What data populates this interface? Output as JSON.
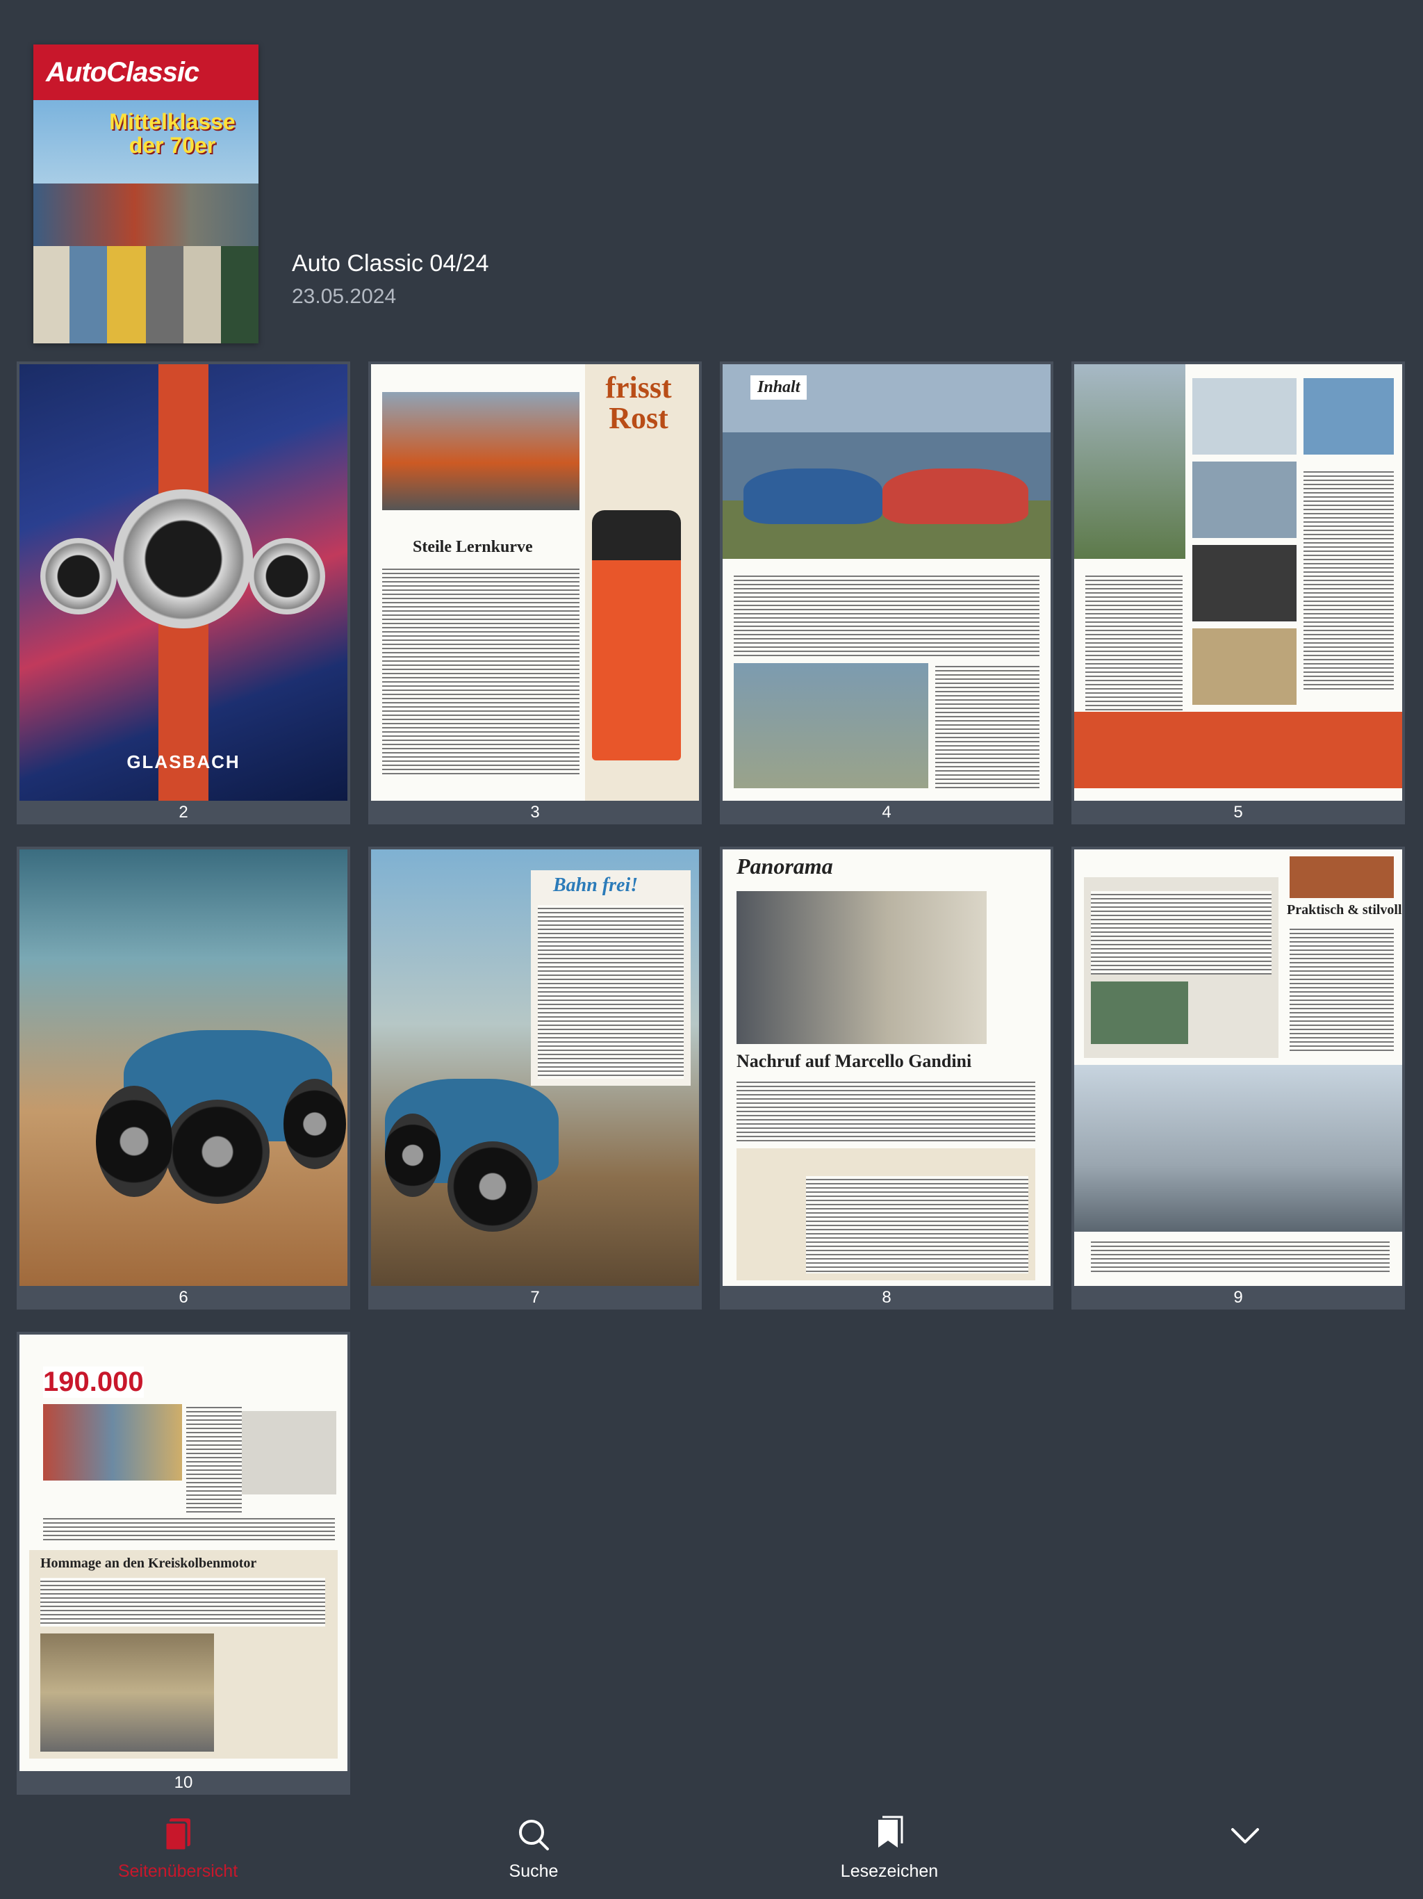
{
  "issue": {
    "title": "Auto Classic 04/24",
    "date": "23.05.2024",
    "cover": {
      "masthead": "AutoClassic",
      "headline": "Mittelklasse der 70er"
    }
  },
  "pages": [
    {
      "number": "2",
      "thumb": "ad-watch",
      "brand": "GLASBACH"
    },
    {
      "number": "3",
      "thumb": "editorial",
      "headline": "Steile Lernkurve",
      "ad_text": "frisst Rost"
    },
    {
      "number": "4",
      "thumb": "contents",
      "headline": "Inhalt"
    },
    {
      "number": "5",
      "thumb": "contents-2"
    },
    {
      "number": "6",
      "thumb": "bugatti-photo"
    },
    {
      "number": "7",
      "thumb": "bugatti-article",
      "headline": "Bahn frei!"
    },
    {
      "number": "8",
      "thumb": "panorama",
      "headline": "Panorama",
      "subheadline": "Nachruf auf Marcello Gandini"
    },
    {
      "number": "9",
      "thumb": "klassiker",
      "headline": "Praktisch & stilvoll"
    },
    {
      "number": "10",
      "thumb": "panorama-2",
      "headline": "190.000",
      "subheadline": "Hommage an den Kreiskolbenmotor"
    }
  ],
  "nav": {
    "pages": "Seitenübersicht",
    "search": "Suche",
    "bookmarks": "Lesezeichen"
  },
  "colors": {
    "background": "#333a44",
    "accent": "#c8172b",
    "card": "#48505c"
  }
}
